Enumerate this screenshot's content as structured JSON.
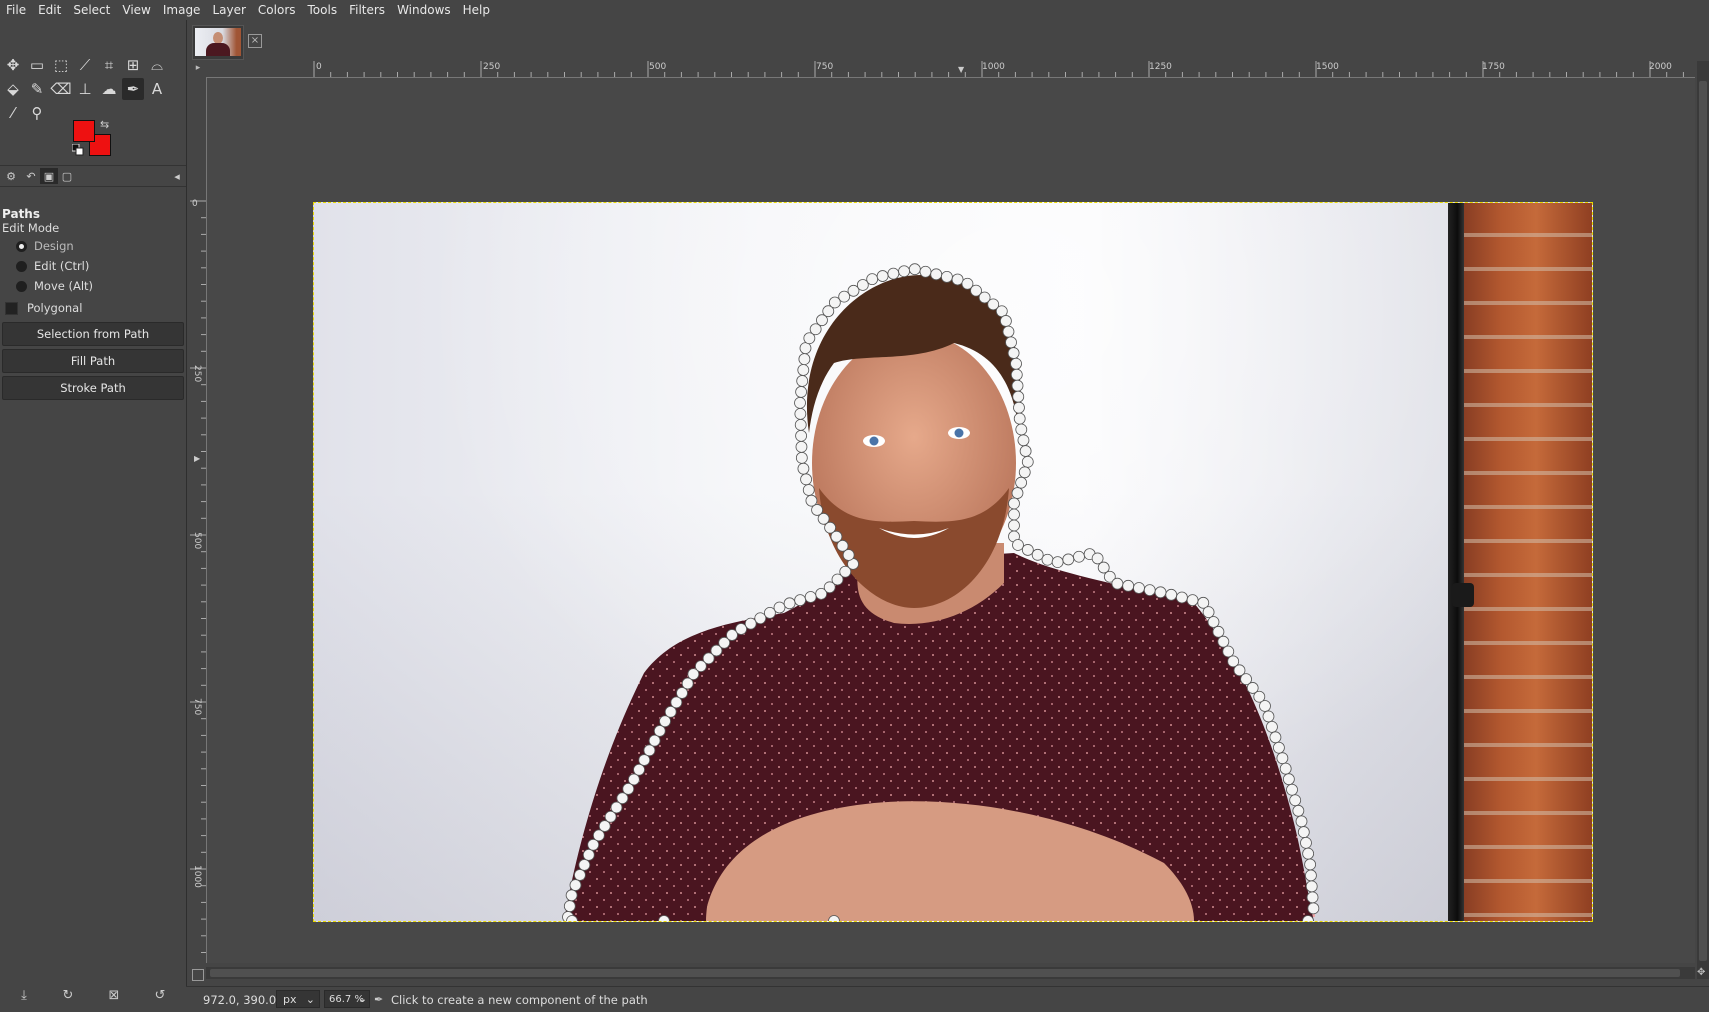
{
  "menu": [
    "File",
    "Edit",
    "Select",
    "View",
    "Image",
    "Layer",
    "Colors",
    "Tools",
    "Filters",
    "Windows",
    "Help"
  ],
  "toolbox": {
    "tools": [
      {
        "name": "move-tool-icon",
        "glyph": "✥"
      },
      {
        "name": "rect-select-tool-icon",
        "glyph": "▭"
      },
      {
        "name": "free-select-tool-icon",
        "glyph": "⬚"
      },
      {
        "name": "fuzzy-select-tool-icon",
        "glyph": "⟋"
      },
      {
        "name": "crop-tool-icon",
        "glyph": "⌗"
      },
      {
        "name": "unified-transform-tool-icon",
        "glyph": "⊞"
      },
      {
        "name": "warp-transform-tool-icon",
        "glyph": "⌓"
      },
      {
        "name": "bucket-fill-tool-icon",
        "glyph": "⬙"
      },
      {
        "name": "paintbrush-tool-icon",
        "glyph": "✎"
      },
      {
        "name": "eraser-tool-icon",
        "glyph": "⌫"
      },
      {
        "name": "clone-tool-icon",
        "glyph": "⊥"
      },
      {
        "name": "smudge-tool-icon",
        "glyph": "☁"
      },
      {
        "name": "paths-tool-icon",
        "glyph": "✒"
      },
      {
        "name": "text-tool-icon",
        "glyph": "A"
      },
      {
        "name": "color-picker-tool-icon",
        "glyph": "⁄"
      },
      {
        "name": "zoom-tool-icon",
        "glyph": "⚲"
      }
    ],
    "fg_color": "#ee1111",
    "bg_color": "#ee1111"
  },
  "tool_options": {
    "title": "Paths",
    "edit_mode_label": "Edit Mode",
    "modes": [
      "Design",
      "Edit (Ctrl)",
      "Move (Alt)"
    ],
    "selected_mode": "Design",
    "polygonal_label": "Polygonal",
    "buttons": [
      "Selection from Path",
      "Fill Path",
      "Stroke Path"
    ]
  },
  "hruler_ticks": [
    "0",
    "250",
    "500",
    "750",
    "1000",
    "1250",
    "1500",
    "1750",
    "2000"
  ],
  "vruler_ticks": [
    "0",
    "250",
    "500",
    "750",
    "1000"
  ],
  "statusbar": {
    "coords": "972.0, 390.0",
    "unit": "px",
    "zoom": "66.7 %",
    "message": "Click to create a new component of the path"
  }
}
